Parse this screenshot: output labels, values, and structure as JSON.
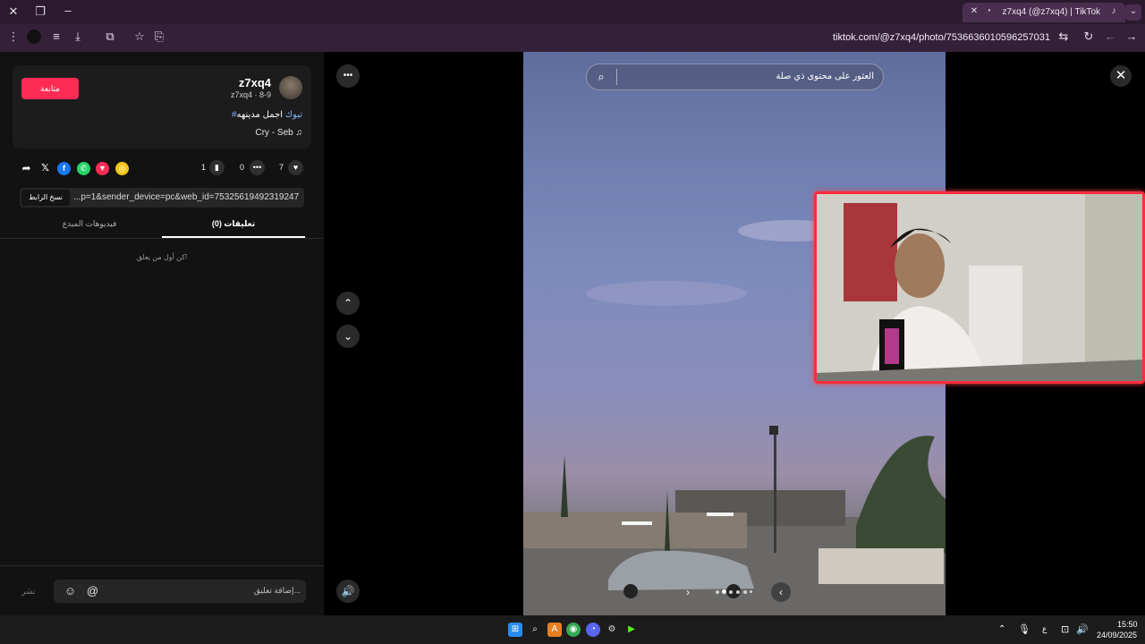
{
  "browser": {
    "tab_title": "z7xq4 (@z7xq4) | TikTok",
    "url": "tiktok.com/@z7xq4/photo/7536636010596257031"
  },
  "profile": {
    "username": "z7xq4",
    "subline": "z7xq4 · 8-9",
    "follow_label": "متابعة",
    "hashtag": "#تبوك",
    "caption_rest": " اجمل مدينهه",
    "music": "Cry - Seb"
  },
  "stats": {
    "likes": "7",
    "comments": "0",
    "bookmarks": "1"
  },
  "link": {
    "url_text": "...p=1&sender_device=pc&web_id=7532561949231924756",
    "copy_label": "نسخ الرابط"
  },
  "tabs": {
    "comments": "تعليقات (0)",
    "creator_videos": "فيديوهات المبدع"
  },
  "comments": {
    "empty_message": "كن أول من يعلق!",
    "placeholder": "إضافة تعليق...",
    "post_label": "نشر"
  },
  "viewer": {
    "search_text": "العثور على محتوى ذي صلة"
  },
  "taskbar": {
    "time": "15:50",
    "date": "24/09/2025",
    "lang": "ع"
  },
  "icons": {
    "close": "close-icon",
    "more": "more-icon",
    "search": "search-icon",
    "volume": "volume-icon"
  }
}
